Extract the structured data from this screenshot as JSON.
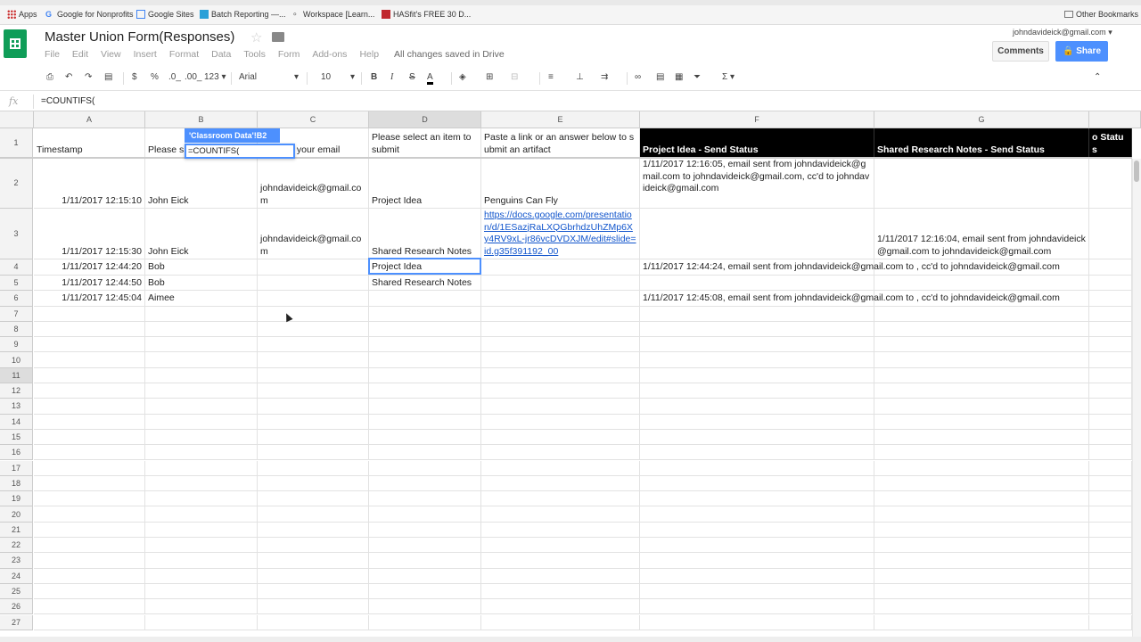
{
  "bookmarks": {
    "apps": "Apps",
    "items": [
      "Google for Nonprofits",
      "Google Sites",
      "Batch Reporting —...",
      "Workspace [Learn...",
      "HASfit's FREE 30 D..."
    ],
    "other": "Other Bookmarks"
  },
  "doc": {
    "title": "Master Union Form(Responses)",
    "menu": [
      "File",
      "Edit",
      "View",
      "Insert",
      "Format",
      "Data",
      "Tools",
      "Form",
      "Add-ons",
      "Help"
    ],
    "save_status": "All changes saved in Drive",
    "account": "johndavideick@gmail.com",
    "comments": "Comments",
    "share": "Share"
  },
  "toolbar": {
    "currency": "$",
    "percent": "%",
    "dec_less": ".0_",
    "dec_more": ".00_",
    "more_formats": "123",
    "font": "Arial",
    "size": "10",
    "bold": "B",
    "italic": "I",
    "strike": "S",
    "text_color": "A",
    "sum": "Σ"
  },
  "formula_bar": {
    "fx": "fx",
    "formula": "=COUNTIFS("
  },
  "editor": {
    "range_tip": "'Classroom Data'!B2",
    "edit_value": "=COUNTIFS("
  },
  "columns": [
    "A",
    "B",
    "C",
    "D",
    "E",
    "F",
    "G"
  ],
  "rows": [
    "1",
    "2",
    "3",
    "4",
    "5",
    "6",
    "7",
    "8",
    "9",
    "10",
    "11",
    "12",
    "13",
    "14",
    "15",
    "16",
    "17",
    "18",
    "19",
    "20",
    "21",
    "22",
    "23",
    "24",
    "25",
    "26",
    "27"
  ],
  "cells": {
    "a1": "Timestamp",
    "b1": "Please s",
    "c1": "se enter your email",
    "d1": "Please select an item to submit",
    "e1": "Paste a link or an answer below to submit an artifact",
    "f1": "Project Idea - Send Status",
    "g1": "Shared Research Notes - Send Status",
    "h1": "First two Status",
    "a2": "1/11/2017 12:15:10",
    "b2": "John Eick",
    "c2": "johndavideick@gmail.com",
    "d2": "Project Idea",
    "e2": "Penguins Can Fly",
    "f2": "1/11/2017 12:16:05, email sent from johndavideick@gmail.com to johndavideick@gmail.com, cc'd to johndavideick@gmail.com",
    "a3": "1/11/2017 12:15:30",
    "b3": "John Eick",
    "c3": "johndavideick@gmail.com",
    "d3": "Shared Research Notes",
    "e3": "https://docs.google.com/presentation/d/1ESazjRaLXQGbrhdzUhZMp6Xy4RV9xL-jr86vcDVDXJM/edit#slide=id.g35f391192_00",
    "g3": "1/11/2017 12:16:04, email sent from johndavideick@gmail.com to johndavideick@gmail.com",
    "a4": "1/11/2017 12:44:20",
    "b4": "Bob",
    "d4": "Project Idea",
    "f4": "1/11/2017 12:44:24, email sent from johndavideick@gmail.com to , cc'd to johndavideick@gmail.com",
    "a5": "1/11/2017 12:44:50",
    "b5": "Bob",
    "d5": "Shared Research Notes",
    "a6": "1/11/2017 12:45:04",
    "b6": "Aimee",
    "f6": "1/11/2017 12:45:08, email sent from johndavideick@gmail.com to , cc'd to johndavideick@gmail.com"
  },
  "colors": {
    "sheets_green": "#0f9d58",
    "share_blue": "#4d90fe",
    "link_blue": "#1155cc"
  }
}
